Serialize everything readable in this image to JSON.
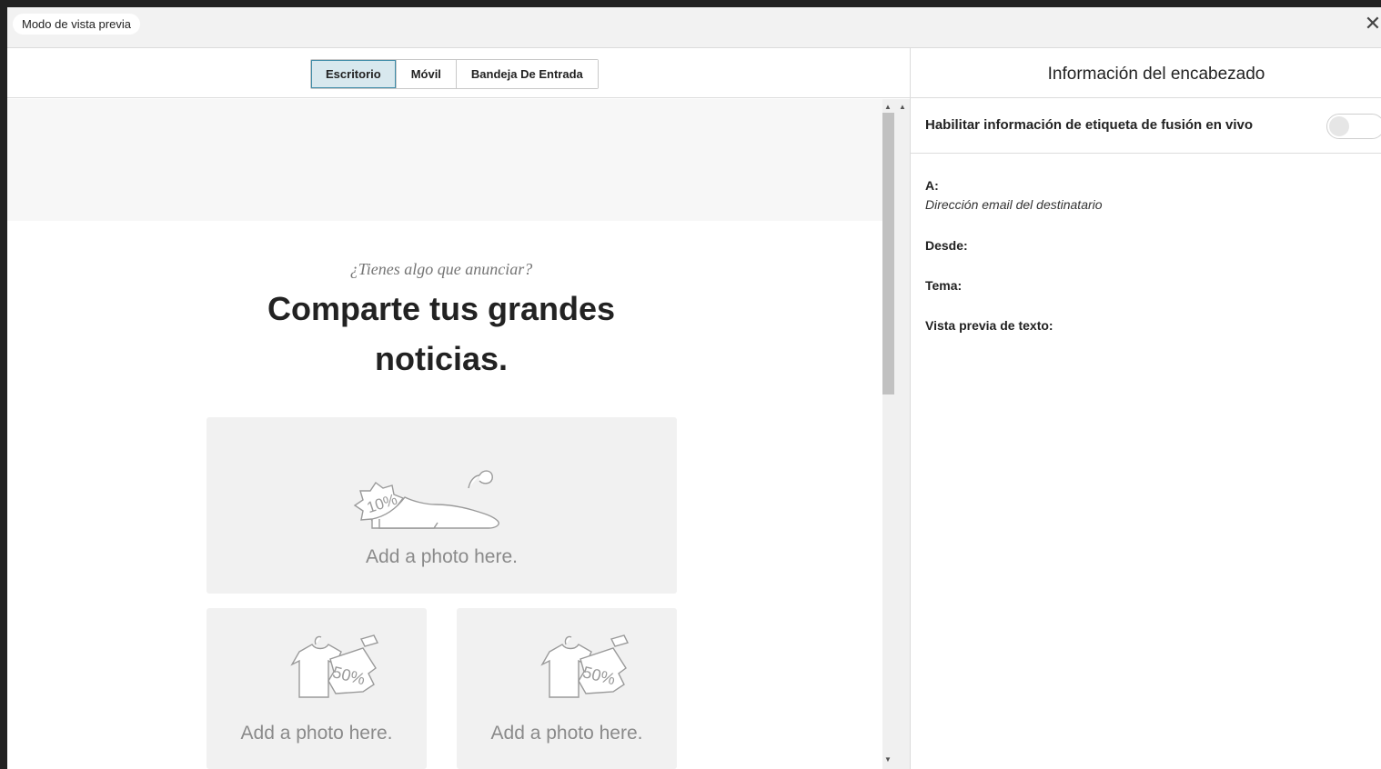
{
  "topbar": {
    "mode_label": "Modo de vista previa",
    "close_glyph": "✕"
  },
  "tabs": [
    {
      "label": "Escritorio",
      "active": true
    },
    {
      "label": "Móvil",
      "active": false
    },
    {
      "label": "Bandeja De Entrada",
      "active": false
    }
  ],
  "email": {
    "eyebrow": "¿Tienes algo que anunciar?",
    "headline": "Comparte tus grandes noticias.",
    "photos": [
      {
        "text": "Add a photo here.",
        "icon": "shoe-sale-icon",
        "badge": "10%"
      },
      {
        "text": "Add a photo here.",
        "icon": "shirt-sale-icon",
        "badge": "50%"
      },
      {
        "text": "Add a photo here.",
        "icon": "shirt-sale-icon",
        "badge": "50%"
      }
    ]
  },
  "header_panel": {
    "title": "Información del encabezado",
    "toggle_label": "Habilitar información de etiqueta de fusión en vivo",
    "toggle_on": false,
    "to_label": "A:",
    "to_value": "Dirección email del destinatario",
    "from_label": "Desde:",
    "subject_label": "Tema:",
    "preview_text_label": "Vista previa de texto:"
  },
  "colors": {
    "active_tab_bg": "#d8e8ee",
    "active_tab_border": "#3f8ca8",
    "placeholder_bg": "#f1f1f1"
  }
}
